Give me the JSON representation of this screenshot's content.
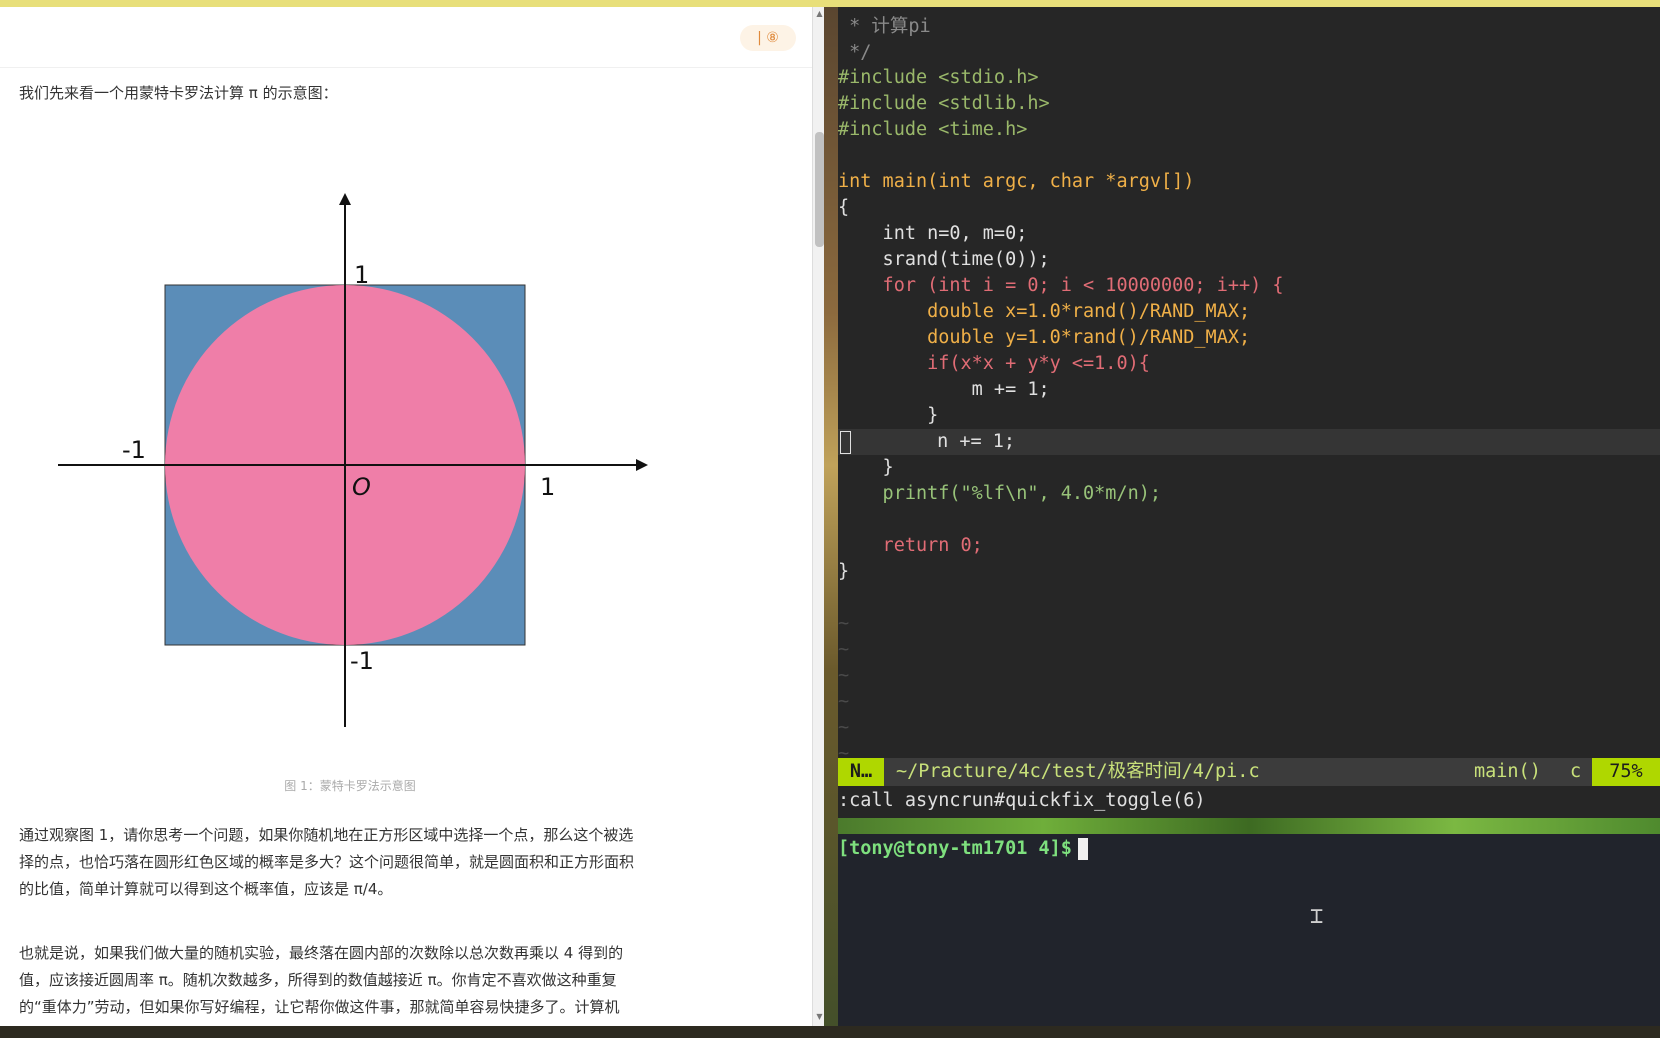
{
  "article": {
    "header_badge": "| ⑧",
    "intro": "我们先来看一个用蒙特卡罗法计算 π 的示意图：",
    "figure_labels": {
      "top": "1",
      "left": "-1",
      "origin": "O",
      "right": "1",
      "bottom": "-1"
    },
    "caption": "图 1：蒙特卡罗法示意图",
    "para1_lines": [
      "通过观察图 1，请你思考一个问题，如果你随机地在正方形区域中选择一个点，那么这个被选",
      "择的点，也恰巧落在圆形红色区域的概率是多大？这个问题很简单，就是圆面积和正方形面积",
      "的比值，简单计算就可以得到这个概率值，应该是 π/4。"
    ],
    "para2_lines": [
      "也就是说，如果我们做大量的随机实验，最终落在圆内部的次数除以总次数再乘以 4 得到的",
      "值，应该接近圆周率 π。随机次数越多，所得到的数值越接近 π。你肯定不喜欢做这种重复",
      "的“重体力”劳动，但如果你写好编程，让它帮你做这件事，那就简单容易快捷多了。计算机"
    ],
    "colors": {
      "square": "#5b8db8",
      "circle": "#ef7ea8"
    }
  },
  "editor": {
    "lines": [
      " * 计算pi",
      " */",
      "#include <stdio.h>",
      "#include <stdlib.h>",
      "#include <time.h>",
      "",
      "int main(int argc, char *argv[])",
      "{",
      "    int n=0, m=0;",
      "    srand(time(0));",
      "    for (int i = 0; i < 10000000; i++) {",
      "        double x=1.0*rand()/RAND_MAX;",
      "        double y=1.0*rand()/RAND_MAX;",
      "        if(x*x + y*y <=1.0){",
      "            m += 1;",
      "        }",
      "        n += 1;",
      "    }",
      "    printf(\"%lf\\n\", 4.0*m/n);",
      "",
      "    return 0;",
      "}"
    ],
    "tildes": [
      "~",
      "~",
      "~",
      "~",
      "~",
      "~"
    ],
    "status": {
      "mode": "N…",
      "path": "~/Practure/4c/test/极客时间/4/pi.c",
      "function": "main()",
      "filetype": "c",
      "percent": "75%"
    },
    "cmdline": ":call asyncrun#quickfix_toggle(6)"
  },
  "terminal": {
    "prompt": "[tony@tony-tm1701 4]$"
  }
}
